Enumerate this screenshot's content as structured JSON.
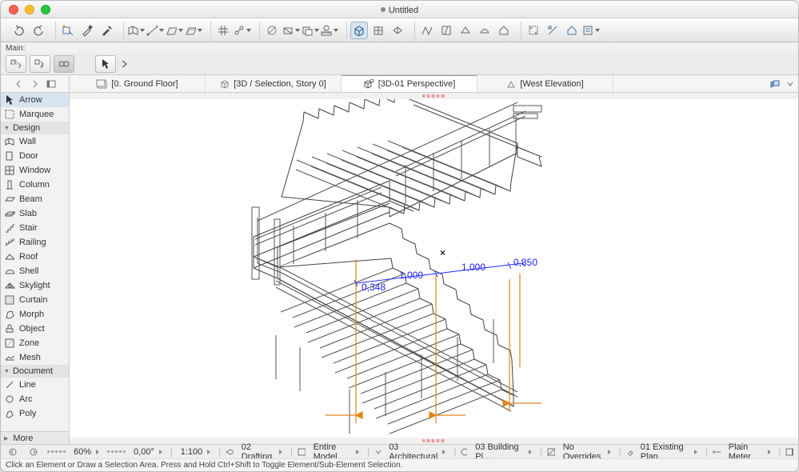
{
  "window": {
    "title": "Untitled"
  },
  "toolbar_label": "Main:",
  "tabs": [
    {
      "label": "[0. Ground Floor]"
    },
    {
      "label": "[3D / Selection, Story 0]"
    },
    {
      "label": "[3D-01 Perspective]"
    },
    {
      "label": "[West Elevation]"
    }
  ],
  "active_tab_index": 2,
  "toolbox": {
    "top_selected": "Arrow",
    "marquee": "Marquee",
    "design_header": "Design",
    "design": [
      "Wall",
      "Door",
      "Window",
      "Column",
      "Beam",
      "Slab",
      "Stair",
      "Railing",
      "Roof",
      "Shell",
      "Skylight",
      "Curtain",
      "Morph",
      "Object",
      "Zone",
      "Mesh"
    ],
    "document_header": "Document",
    "document": [
      "Line",
      "Arc",
      "Poly"
    ],
    "footer": "More"
  },
  "dimensions": {
    "d1": "0,348",
    "d2": "1,000",
    "d3": "1,000",
    "d4": "0,350"
  },
  "status": {
    "zoom": "60%",
    "angle": "0,00°",
    "scale": "1:100",
    "layer": "02 Drafting",
    "model": "Entire Model",
    "layer_combo": "03 Architectural",
    "pen_set": "03 Building Pl…",
    "overrides": "No Overrides",
    "reno": "01 Existing Plan",
    "dim": "Plain Meter"
  },
  "hint": "Click an Element or Draw a Selection Area. Press and Hold Ctrl+Shift to Toggle Element/Sub-Element Selection."
}
